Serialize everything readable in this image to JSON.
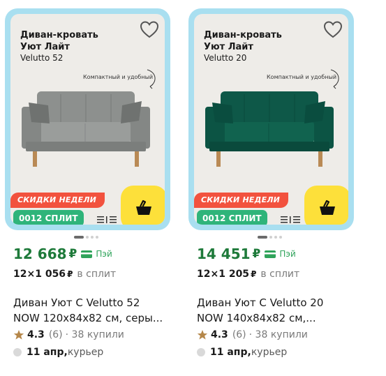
{
  "products": [
    {
      "photo_title": "Диван-кровать\nУют Лайт",
      "photo_title_1": "Диван-кровать",
      "photo_title_2": "Уют Лайт",
      "photo_subtitle": "Velutto 52",
      "photo_note": "Компактный и удобный",
      "promo_badge": "СКИДКИ НЕДЕЛИ",
      "split_badge": "0012 СПЛИТ",
      "sofa_color": "#8a8d8b",
      "price": "12 668",
      "currency": "₽",
      "pay_label": "Пэй",
      "installment_count": "12×1 056",
      "installment_currency": "₽",
      "installment_note": "в сплит",
      "name_line1": "Диван Уют С Velutto 52",
      "name_line2": "NOW 120x84x82 см, серы...",
      "rating": "4.3",
      "reviews": "(6)",
      "bought": "· 38 купили",
      "delivery_date": "11 апр,",
      "delivery_type": " курьер"
    },
    {
      "photo_title_1": "Диван-кровать",
      "photo_title_2": "Уют Лайт",
      "photo_subtitle": "Velutto 20",
      "photo_note": "Компактный и удобный",
      "promo_badge": "СКИДКИ НЕДЕЛИ",
      "split_badge": "0012 СПЛИТ",
      "sofa_color": "#0f5c4a",
      "price": "14 451",
      "currency": "₽",
      "pay_label": "Пэй",
      "installment_count": "12×1 205",
      "installment_currency": "₽",
      "installment_note": "в сплит",
      "name_line1": "Диван Уют С Velutto 20",
      "name_line2": "NOW 140x84x82 см,...",
      "rating": "4.3",
      "reviews": "(6)",
      "bought": "· 38 купили",
      "delivery_date": "11 апр,",
      "delivery_type": " курьер"
    }
  ],
  "icons": {
    "favorite": "heart-icon",
    "cart": "basket-icon",
    "pay": "card-icon",
    "rating": "star-icon"
  },
  "colors": {
    "frame": "#a9dff0",
    "price_green": "#1e7a3a",
    "promo_red": "#f2523e",
    "split_green": "#2fb47a",
    "cart_yellow": "#fde03a",
    "star": "#b5874a"
  }
}
